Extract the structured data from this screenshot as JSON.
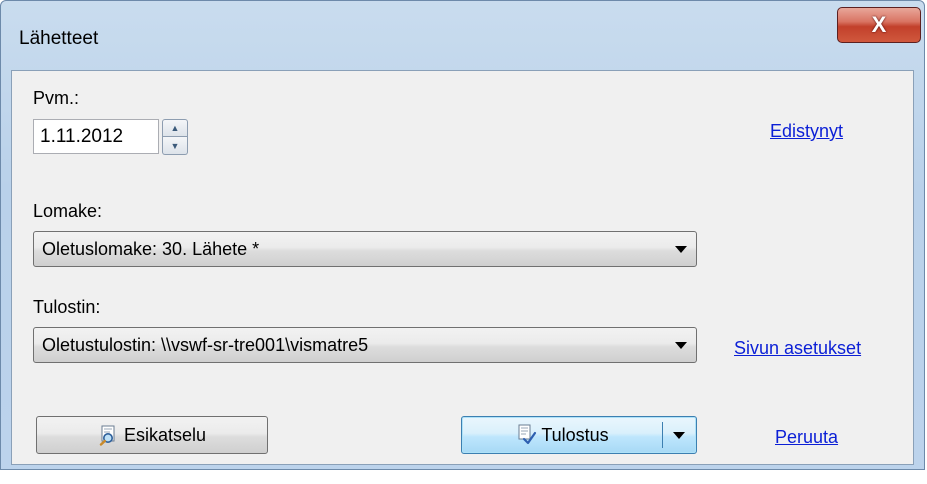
{
  "window": {
    "title": "Lähetteet",
    "close_label": "X"
  },
  "date": {
    "label": "Pvm.:",
    "value": "1.11.2012"
  },
  "links": {
    "advanced": "Edistynyt",
    "page_setup": "Sivun asetukset",
    "cancel": "Peruuta"
  },
  "form": {
    "label": "Lomake:",
    "selected": "Oletuslomake: 30. Lähete *"
  },
  "printer": {
    "label": "Tulostin:",
    "selected": "Oletustulostin: \\\\vswf-sr-tre001\\vismatre5"
  },
  "buttons": {
    "preview": "Esikatselu",
    "print": "Tulostus"
  },
  "icons": {
    "preview": "magnifier-document-icon",
    "print": "printer-document-icon",
    "spin_up": "spin-up-icon",
    "spin_down": "spin-down-icon",
    "dropdown": "chevron-down-icon",
    "close": "close-icon"
  },
  "colors": {
    "link": "#0b1fd6",
    "close_button": "#c2402b",
    "default_button": "#bee6fd"
  }
}
